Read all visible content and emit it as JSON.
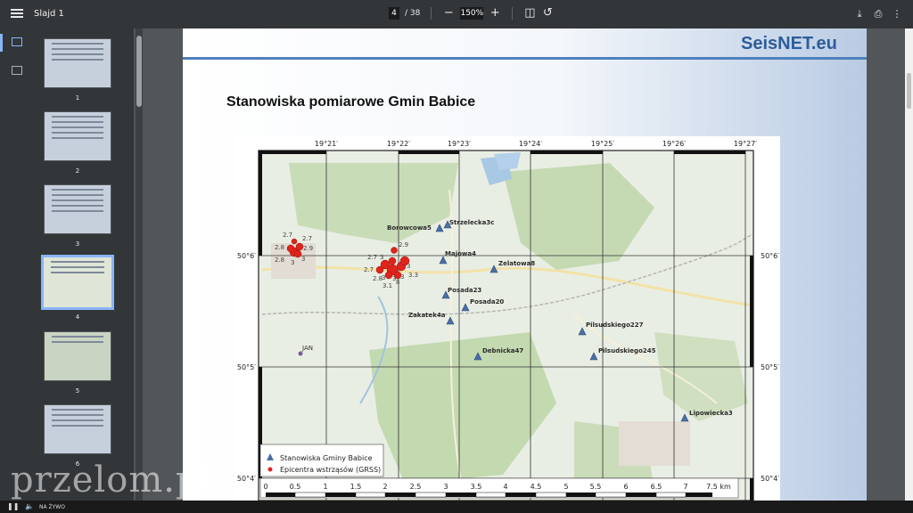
{
  "toolbar": {
    "doc_title": "Slajd 1",
    "current_page": "4",
    "page_total": "/ 38",
    "zoom": "150%",
    "zoom_out_label": "−",
    "zoom_in_label": "+",
    "menu_icon": "menu-icon",
    "fit_icon": "fit-page-icon",
    "rotate_icon": "rotate-icon",
    "download_icon": "download-icon",
    "print_icon": "print-icon",
    "more_icon": "more-vert-icon"
  },
  "thumbnails": [
    {
      "num": "1"
    },
    {
      "num": "2"
    },
    {
      "num": "3"
    },
    {
      "num": "4",
      "selected": true
    },
    {
      "num": "5"
    },
    {
      "num": "6"
    }
  ],
  "slide": {
    "brand": "SeisNET.eu",
    "title": "Stanowiska pomiarowe Gmin Babice"
  },
  "map": {
    "lon_labels": [
      "19°21′",
      "19°22′",
      "19°23′",
      "19°24′",
      "19°25′",
      "19°26′",
      "19°27′"
    ],
    "lat_labels": [
      "50°6′",
      "50°5′",
      "50°4′"
    ],
    "stations": [
      {
        "name": "Borowcowa5"
      },
      {
        "name": "Strzelecka3c"
      },
      {
        "name": "Majowa4"
      },
      {
        "name": "Zelatowa8"
      },
      {
        "name": "Posada23"
      },
      {
        "name": "Posada20"
      },
      {
        "name": "Zakatek4a"
      },
      {
        "name": "Debnicka47"
      },
      {
        "name": "Pilsudskiego227"
      },
      {
        "name": "Pilsudskiego245"
      },
      {
        "name": "Lipowiecka3"
      }
    ],
    "other_station": "JAN",
    "magnitudes": [
      "2.7",
      "2.7",
      "2.8",
      "2.9",
      "2.8",
      "3",
      "3",
      "2.9",
      "2.7",
      "3",
      "2.7",
      "3",
      "3",
      "3",
      "3.3",
      "3.1",
      "8",
      "3",
      "2.8"
    ],
    "legend": {
      "stations": "Stanowiska Gminy Babice",
      "epicentres": "Epicentra wstrząsów (GRSS)"
    },
    "scale": [
      "0",
      "0.5",
      "1",
      "1.5",
      "2",
      "2.5",
      "3",
      "3.5",
      "4",
      "4.5",
      "5",
      "5.5",
      "6",
      "6.5",
      "7",
      "7.5 km"
    ],
    "colors": {
      "station": "#4a6fa5",
      "epicentre": "#e0241b"
    }
  },
  "player": {
    "play_icon": "pause-icon",
    "volume_icon": "volume-icon",
    "live_label": "NA ŻYWO"
  },
  "watermark": "przelom.pl"
}
